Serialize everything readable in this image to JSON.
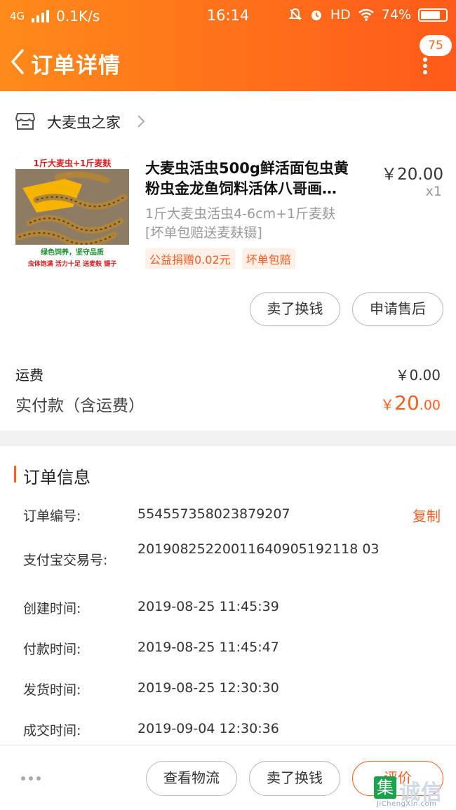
{
  "status_bar": {
    "network": "4G",
    "speed": "0.1K/s",
    "time": "16:14",
    "hd": "HD",
    "battery": "74%"
  },
  "nav": {
    "title": "订单详情",
    "badge": "75"
  },
  "shop": {
    "name": "大麦虫之家"
  },
  "product": {
    "title_line1": "大麦虫活虫500g鲜活面包虫黄",
    "title_line2": "粉虫金龙鱼饲料活体八哥画…",
    "price": "￥20.00",
    "qty": "x1",
    "sku_line1": "1斤大麦虫活虫4-6cm+1斤麦麸",
    "sku_line2": "[坏单包赔送麦麸镊]",
    "tags": [
      "公益捐赠0.02元",
      "坏单包赔"
    ],
    "image": {
      "top_text": "1斤大麦虫+1斤麦麸",
      "mid_text": "绿色饲养，坚守品质",
      "bottom_text": "虫体饱满 活力十足 送麦麸 镊子"
    }
  },
  "actions": {
    "sell": "卖了换钱",
    "after_sales": "申请售后"
  },
  "fees": {
    "shipping_label": "运费",
    "shipping_value": "￥0.00",
    "paid_label": "实付款（含运费）",
    "paid_symbol": "￥",
    "paid_int": "20",
    "paid_dec": ".00"
  },
  "order_info": {
    "title": "订单信息",
    "copy_label": "复制",
    "rows": [
      {
        "label": "订单编号:",
        "value": "554557358023879207"
      },
      {
        "label": "支付宝交易号:",
        "value": "20190825220011640905192118 03"
      },
      {
        "label": "创建时间:",
        "value": "2019-08-25 11:45:39"
      },
      {
        "label": "付款时间:",
        "value": "2019-08-25 11:45:47"
      },
      {
        "label": "发货时间:",
        "value": "2019-08-25 12:30:30"
      },
      {
        "label": "成交时间:",
        "value": "2019-09-04 12:30:36"
      }
    ]
  },
  "bottom_bar": {
    "logistics": "查看物流",
    "sell": "卖了换钱",
    "review": "评价"
  },
  "watermark": {
    "box": "集",
    "cn": "诚信",
    "en": "JiChengXin.com"
  },
  "colors": {
    "accent": "#ff5c1f",
    "header_start": "#ff8a1a",
    "header_end": "#ff5a1a"
  }
}
